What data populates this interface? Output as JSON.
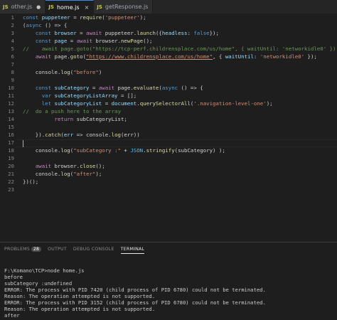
{
  "tabs": [
    {
      "label": "other.js",
      "icon": "js-icon",
      "modified": false,
      "active": false
    },
    {
      "label": "home.js",
      "icon": "js-icon",
      "modified": false,
      "active": true
    },
    {
      "label": "getResponse.js",
      "icon": "js-icon",
      "modified": false,
      "active": false
    }
  ],
  "tab_markers": {
    "dot": "●",
    "close": "×"
  },
  "line_numbers": [
    "1",
    "2",
    "3",
    "4",
    "5",
    "6",
    "7",
    "8",
    "9",
    "10",
    "11",
    "12",
    "13",
    "14",
    "15",
    "16",
    "17",
    "18",
    "19",
    "20",
    "21",
    "22",
    "23"
  ],
  "code_lines": {
    "l1": [
      "const",
      " ",
      "puppeteer",
      " = ",
      "require",
      "(",
      "'puppeteer'",
      ");"
    ],
    "l2": [
      "(",
      "async",
      " () => {"
    ],
    "l3": [
      "    ",
      "const",
      " ",
      "browser",
      " = ",
      "await",
      " puppeteer.",
      "launch",
      "({",
      "headless",
      ": ",
      "false",
      "});"
    ],
    "l4": [
      "    ",
      "const",
      " ",
      "page",
      " = ",
      "await",
      " browser.",
      "newPage",
      "();"
    ],
    "l5": "//    await page.goto(\"https://tcp-perf.childrensplace.com/us/home\", { waitUntil: 'networkidle0' });",
    "l6": [
      "    ",
      "await",
      " page.",
      "goto",
      "(",
      "\"https://www.childrensplace.com/us/home\"",
      ", { ",
      "waitUntil",
      ": ",
      "'networkidle0'",
      " });"
    ],
    "l8": [
      "    console.",
      "log",
      "(",
      "\"before\"",
      ")"
    ],
    "l10": [
      "    ",
      "const",
      " ",
      "subCategory",
      " = ",
      "await",
      " page.",
      "evaluate",
      "(",
      "async",
      " () => {"
    ],
    "l11": [
      "      ",
      "var",
      " ",
      "subCategoryListArray",
      " = [];"
    ],
    "l12": [
      "      ",
      "let",
      " ",
      "subCategoryList",
      " = ",
      "document",
      ".",
      "querySelectorAll",
      "(",
      "'.navigation-level-one'",
      ");"
    ],
    "l13": "//  do a push here to the array",
    "l14": [
      "          ",
      "return",
      " subCategoryList;"
    ],
    "l16": [
      "    }).",
      "catch",
      "(",
      "err",
      " => console.",
      "log",
      "(err))"
    ],
    "l18": [
      "    console.",
      "log",
      "(",
      "\"subCategory :\"",
      " + ",
      "JSON",
      ".",
      "stringify",
      "(subCategory) );"
    ],
    "l20": [
      "    ",
      "await",
      " browser.",
      "close",
      "();"
    ],
    "l21": [
      "    console.",
      "log",
      "(",
      "\"after\"",
      ");"
    ],
    "l22": "})();"
  },
  "panel": {
    "tabs": [
      "PROBLEMS",
      "OUTPUT",
      "DEBUG CONSOLE",
      "TERMINAL"
    ],
    "problems_count": "28",
    "active_tab": "TERMINAL"
  },
  "terminal": {
    "lines": [
      "F:\\Komano\\TCP>node home.js",
      "before",
      "subCategory :undefined",
      "ERROR: The process with PID 7420 (child process of PID 6780) could not be terminated.",
      "Reason: The operation attempted is not supported.",
      "ERROR: The process with PID 3152 (child process of PID 6780) could not be terminated.",
      "Reason: The operation attempted is not supported.",
      "after"
    ]
  },
  "colors": {
    "keyword": "#569cd6",
    "control": "#c586c0",
    "function": "#dcdcaa",
    "variable": "#9cdcfe",
    "string": "#ce9178",
    "comment": "#6a9955"
  }
}
